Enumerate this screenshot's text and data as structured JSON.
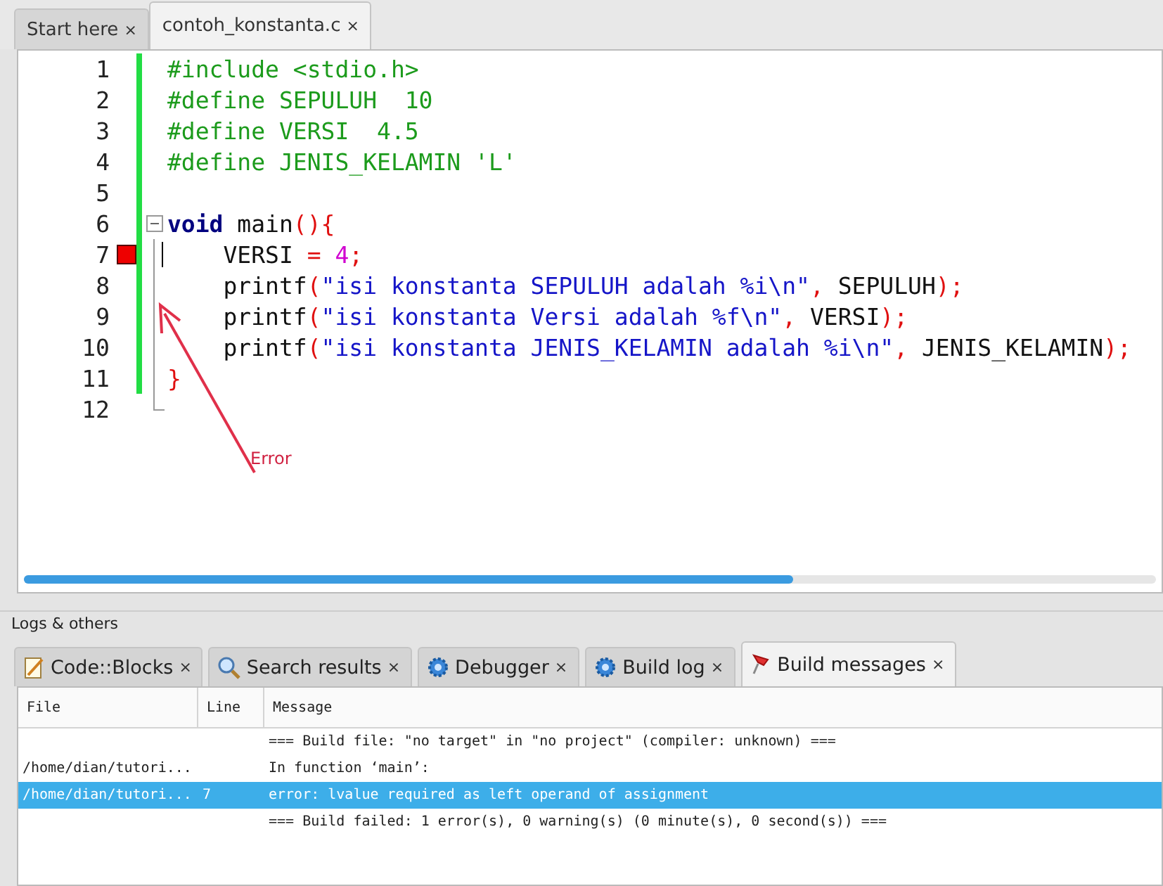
{
  "editor_tabs": [
    {
      "label": "Start here",
      "close": "×",
      "selected": false
    },
    {
      "label": "contoh_konstanta.c",
      "close": "×",
      "selected": true
    }
  ],
  "code_lines": [
    {
      "number": "1",
      "changed": true,
      "error": false,
      "kind": "plain",
      "tokens": [
        {
          "kind": "pp",
          "text": "#include <stdio.h>"
        }
      ]
    },
    {
      "number": "2",
      "changed": true,
      "error": false,
      "kind": "plain",
      "tokens": [
        {
          "kind": "pp",
          "text": "#define SEPULUH  10"
        }
      ]
    },
    {
      "number": "3",
      "changed": true,
      "error": false,
      "kind": "plain",
      "tokens": [
        {
          "kind": "pp",
          "text": "#define VERSI  4.5"
        }
      ]
    },
    {
      "number": "4",
      "changed": true,
      "error": false,
      "kind": "plain",
      "tokens": [
        {
          "kind": "pp",
          "text": "#define JENIS_KELAMIN 'L'"
        }
      ]
    },
    {
      "number": "5",
      "changed": true,
      "error": false,
      "kind": "plain"
    },
    {
      "number": "6",
      "changed": true,
      "error": false,
      "kind": "foldstart",
      "tokens": [
        {
          "kind": "kw",
          "text": "void"
        },
        {
          "kind": "plain",
          "text": " main"
        },
        {
          "kind": "op",
          "text": "(){"
        }
      ]
    },
    {
      "number": "7",
      "changed": true,
      "error": true,
      "kind": "foldbody",
      "tokens": [
        {
          "kind": "plain",
          "text": "    VERSI "
        },
        {
          "kind": "op",
          "text": "="
        },
        {
          "kind": "num",
          "text": " 4"
        },
        {
          "kind": "op",
          "text": ";"
        }
      ]
    },
    {
      "number": "8",
      "changed": true,
      "error": false,
      "kind": "foldbody",
      "tokens": [
        {
          "kind": "plain",
          "text": "    printf"
        },
        {
          "kind": "op",
          "text": "("
        },
        {
          "kind": "str",
          "text": "\"isi konstanta SEPULUH adalah %i\\n\""
        },
        {
          "kind": "op",
          "text": ","
        },
        {
          "kind": "plain",
          "text": " SEPULUH"
        },
        {
          "kind": "op",
          "text": ");"
        }
      ]
    },
    {
      "number": "9",
      "changed": true,
      "error": false,
      "kind": "foldbody",
      "tokens": [
        {
          "kind": "plain",
          "text": "    printf"
        },
        {
          "kind": "op",
          "text": "("
        },
        {
          "kind": "str",
          "text": "\"isi konstanta Versi adalah %f\\n\""
        },
        {
          "kind": "op",
          "text": ","
        },
        {
          "kind": "plain",
          "text": " VERSI"
        },
        {
          "kind": "op",
          "text": ");"
        }
      ]
    },
    {
      "number": "10",
      "changed": true,
      "error": false,
      "kind": "foldbody",
      "tokens": [
        {
          "kind": "plain",
          "text": "    printf"
        },
        {
          "kind": "op",
          "text": "("
        },
        {
          "kind": "str",
          "text": "\"isi konstanta JENIS_KELAMIN adalah %i\\n\""
        },
        {
          "kind": "op",
          "text": ","
        },
        {
          "kind": "plain",
          "text": " JENIS_KELAMIN"
        },
        {
          "kind": "op",
          "text": ");"
        }
      ]
    },
    {
      "number": "11",
      "changed": true,
      "error": false,
      "kind": "foldbody",
      "tokens": [
        {
          "kind": "op",
          "text": "}"
        }
      ]
    },
    {
      "number": "12",
      "changed": false,
      "error": false,
      "kind": "foldend"
    }
  ],
  "annotation": {
    "label": "Error"
  },
  "logs_panel": {
    "title": "Logs & others",
    "tabs": [
      {
        "label": "Code::Blocks",
        "kind": "notepad",
        "close": "×",
        "selected": false
      },
      {
        "label": "Search results",
        "kind": "magnifier",
        "close": "×",
        "selected": false
      },
      {
        "label": "Debugger",
        "kind": "gear",
        "close": "×",
        "selected": false
      },
      {
        "label": "Build log",
        "kind": "gear",
        "close": "×",
        "selected": false
      },
      {
        "label": "Build messages",
        "kind": "pin",
        "close": "×",
        "selected": true
      }
    ],
    "columns": [
      "File",
      "Line",
      "Message"
    ],
    "rows": [
      {
        "line": "",
        "message": "=== Build file: \"no target\" in \"no project\" (compiler: unknown) ===",
        "selected": false
      },
      {
        "file": "/home/dian/tutori...",
        "message": "In function ‘main’:",
        "selected": false
      },
      {
        "file": "/home/dian/tutori...",
        "line": "7",
        "message": "error: lvalue required as left operand of assignment",
        "selected": true
      },
      {
        "message": "=== Build failed: 1 error(s), 0 warning(s) (0 minute(s), 0 second(s)) ===",
        "selected": false
      }
    ]
  }
}
